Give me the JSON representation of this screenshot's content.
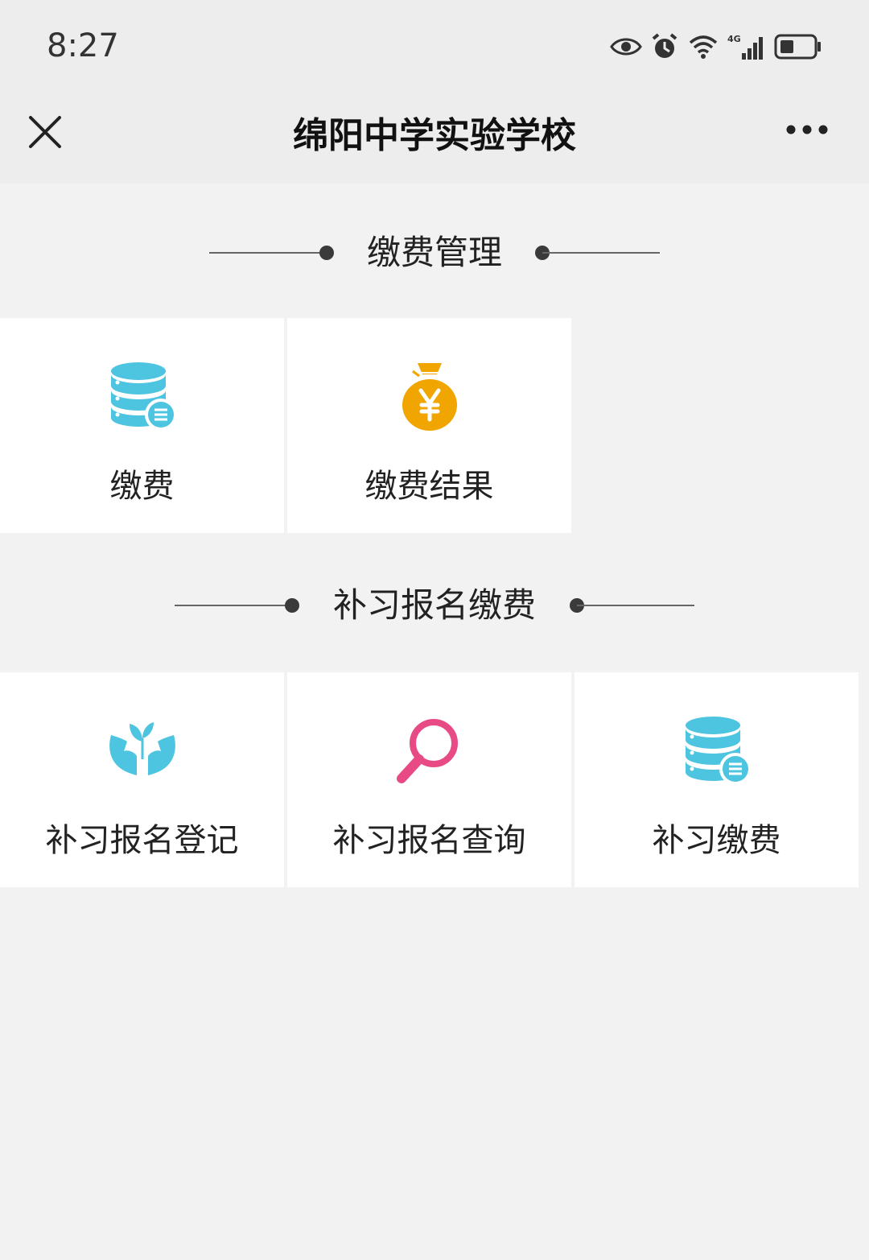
{
  "status_bar": {
    "time": "8:27",
    "icons": [
      "eye-icon",
      "alarm-icon",
      "wifi-icon",
      "signal-4g-icon",
      "battery-icon"
    ]
  },
  "header": {
    "title": "绵阳中学实验学校",
    "close_icon": "close-icon",
    "more_icon": "more-icon"
  },
  "sections": [
    {
      "title": "缴费管理",
      "tiles": [
        {
          "label": "缴费",
          "icon": "database-list-icon",
          "color": "#4dc4e0"
        },
        {
          "label": "缴费结果",
          "icon": "money-bag-yuan-icon",
          "color": "#f0a500"
        }
      ]
    },
    {
      "title": "补习报名缴费",
      "tiles": [
        {
          "label": "补习报名登记",
          "icon": "hands-plant-icon",
          "color": "#4dc4e0"
        },
        {
          "label": "补习报名查询",
          "icon": "magnifier-icon",
          "color": "#e84a86"
        },
        {
          "label": "补习缴费",
          "icon": "database-list-icon",
          "color": "#4dc4e0"
        }
      ]
    }
  ],
  "colors": {
    "background": "#f2f2f2",
    "bar": "#ededed",
    "tile": "#ffffff",
    "cyan": "#4dc4e0",
    "gold": "#f0a500",
    "pink": "#e84a86"
  }
}
